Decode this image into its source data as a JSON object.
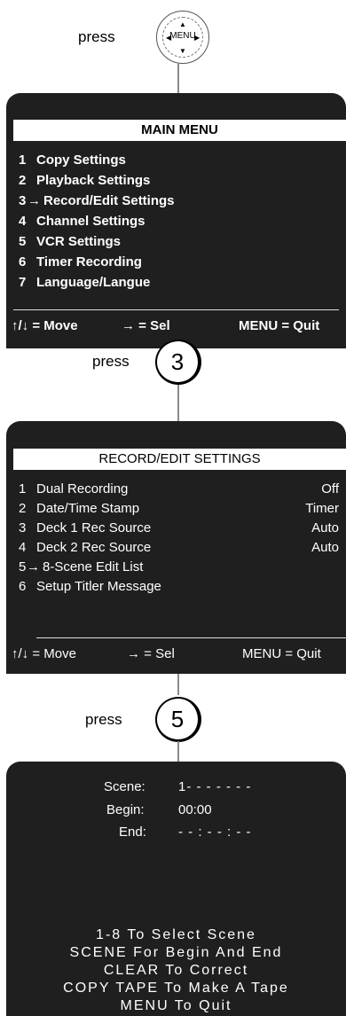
{
  "step1": {
    "press_label": "press",
    "button_label": "MENU"
  },
  "main_menu": {
    "title": "MAIN MENU",
    "items": [
      {
        "num": "1",
        "label": "Copy Settings",
        "selected": false
      },
      {
        "num": "2",
        "label": "Playback Settings",
        "selected": false
      },
      {
        "num": "3",
        "label": "Record/Edit Settings",
        "selected": true
      },
      {
        "num": "4",
        "label": "Channel Settings",
        "selected": false
      },
      {
        "num": "5",
        "label": "VCR Settings",
        "selected": false
      },
      {
        "num": "6",
        "label": "Timer Recording",
        "selected": false
      },
      {
        "num": "7",
        "label": "Language/Langue",
        "selected": false
      }
    ],
    "footer": {
      "move": "↑/↓ = Move",
      "sel": "→ = Sel",
      "quit": "MENU = Quit"
    }
  },
  "step2": {
    "press_label": "press",
    "button_label": "3"
  },
  "record_menu": {
    "title": "RECORD/EDIT SETTINGS",
    "items": [
      {
        "num": "1",
        "label": "Dual Recording",
        "value": "Off"
      },
      {
        "num": "2",
        "label": "Date/Time Stamp",
        "value": "Timer"
      },
      {
        "num": "3",
        "label": "Deck 1 Rec Source",
        "value": "Auto"
      },
      {
        "num": "4",
        "label": "Deck 2 Rec Source",
        "value": "Auto"
      },
      {
        "num": "5",
        "label": "8-Scene Edit List",
        "value": ""
      },
      {
        "num": "6",
        "label": "Setup Titler Message",
        "value": ""
      }
    ],
    "selected_index": 4,
    "footer": {
      "move": "↑/↓ = Move",
      "sel": "→ = Sel",
      "quit": "MENU = Quit"
    }
  },
  "step3": {
    "press_label": "press",
    "button_label": "5"
  },
  "scene_screen": {
    "scene_label": "Scene:",
    "scene_value": "1- - - - - - -",
    "begin_label": "Begin:",
    "begin_value": "00:00",
    "end_label": "End:",
    "end_value": "- - : - - : - -",
    "help": [
      "1-8 To Select Scene",
      "SCENE For Begin And End",
      "CLEAR To Correct",
      "COPY TAPE To Make A Tape",
      "MENU To Quit"
    ]
  },
  "colors": {
    "screen_bg": "#1f1f1f",
    "screen_text": "#ffffff",
    "connector": "#8a8a8a"
  }
}
